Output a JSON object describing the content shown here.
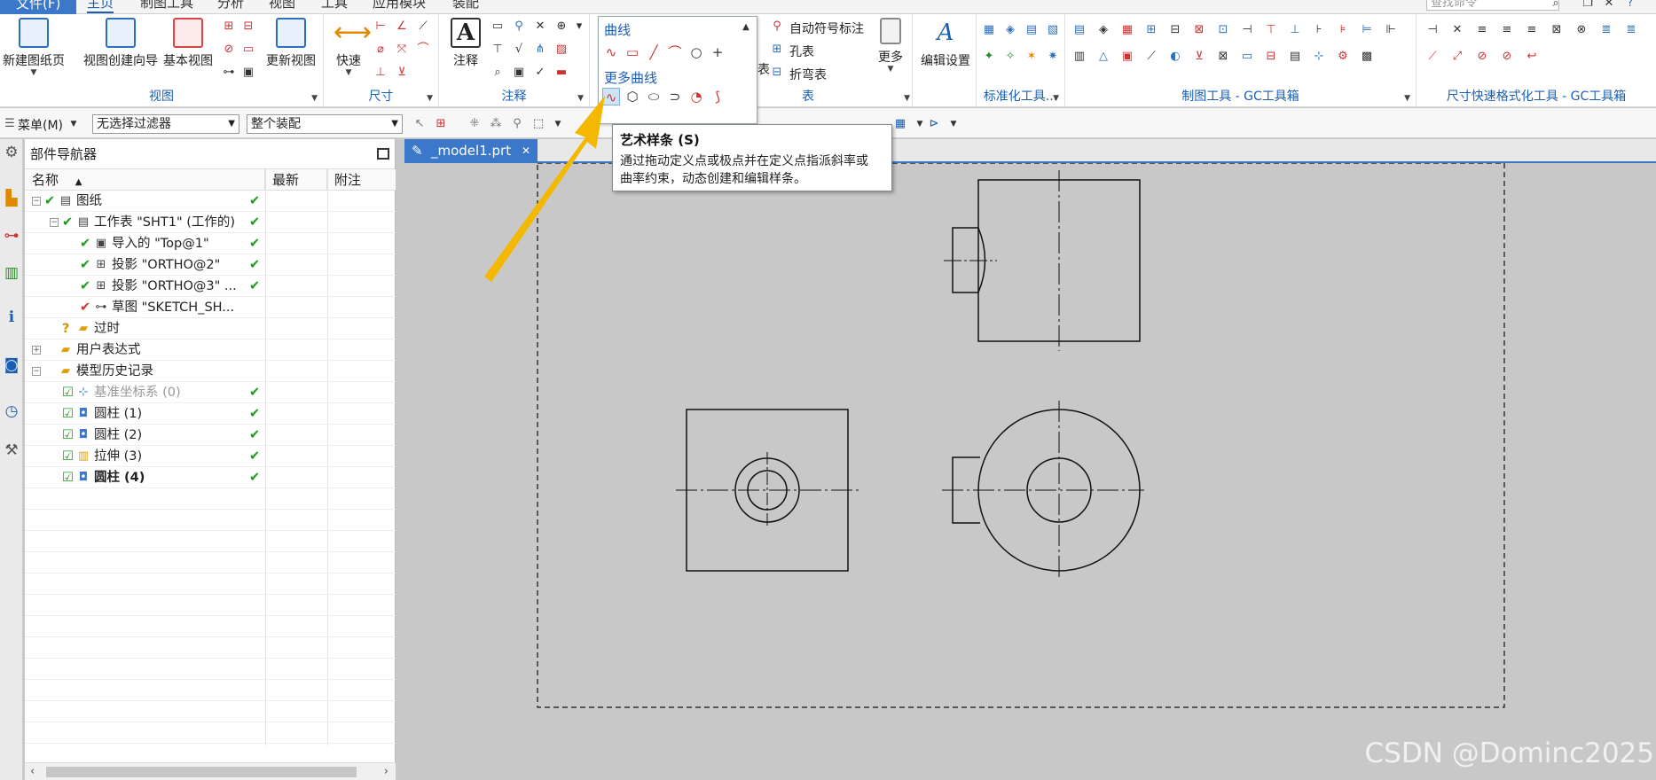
{
  "menubar": {
    "tabs": [
      "文件(F)",
      "主页",
      "制图工具",
      "分析",
      "视图",
      "工具",
      "应用模块",
      "装配"
    ],
    "search_placeholder": "查找命令"
  },
  "ribbon": {
    "new_sheet": "新建图纸页",
    "view_wizard": "视图创建向导",
    "base_view": "基本视图",
    "update_view": "更新视图",
    "group_view": "视图",
    "quick": "快速",
    "group_dimension": "尺寸",
    "annotation": "注释",
    "group_annotation": "注释",
    "auto_symbol": "自动符号标注",
    "hole_table": "孔表",
    "bend_table": "折弯表",
    "table_partial": "表",
    "group_table": "表",
    "more": "更多",
    "edit_settings": "编辑设置",
    "group_std": "标准化工具...",
    "group_gc": "制图工具 - GC工具箱",
    "group_dimfmt": "尺寸快速格式化工具 - GC工具箱"
  },
  "curve_panel": {
    "title": "曲线",
    "more_title": "更多曲线"
  },
  "toolbar2": {
    "menu_label": "菜单(M)",
    "filter": "无选择过滤器",
    "assembly": "整个装配"
  },
  "tooltip": {
    "title": "艺术样条 (S)",
    "line1": "通过拖动定义点或极点并在定义点指派斜率或",
    "line2": "曲率约束，动态创建和编辑样条。"
  },
  "navigator": {
    "title": "部件导航器",
    "col_name": "名称",
    "col_latest": "最新",
    "col_note": "附注",
    "rows": [
      {
        "label": "图纸",
        "indent": 0,
        "latest": "✔"
      },
      {
        "label": "工作表 \"SHT1\" (工作的)",
        "indent": 1,
        "latest": "✔"
      },
      {
        "label": "导入的 \"Top@1\"",
        "indent": 2,
        "latest": "✔"
      },
      {
        "label": "投影 \"ORTHO@2\"",
        "indent": 2,
        "latest": "✔"
      },
      {
        "label": "投影 \"ORTHO@3\" ...",
        "indent": 2,
        "latest": "✔"
      },
      {
        "label": "草图 \"SKETCH_SH...",
        "indent": 2,
        "latest": ""
      },
      {
        "label": "过时",
        "indent": 1,
        "latest": ""
      },
      {
        "label": "用户表达式",
        "indent": 0,
        "latest": ""
      },
      {
        "label": "模型历史记录",
        "indent": 0,
        "latest": ""
      },
      {
        "label": "基准坐标系 (0)",
        "indent": 1,
        "latest": "✔"
      },
      {
        "label": "圆柱 (1)",
        "indent": 1,
        "latest": "✔"
      },
      {
        "label": "圆柱 (2)",
        "indent": 1,
        "latest": "✔"
      },
      {
        "label": "拉伸 (3)",
        "indent": 1,
        "latest": "✔"
      },
      {
        "label": "圆柱 (4)",
        "indent": 1,
        "latest": "✔"
      }
    ]
  },
  "document_tab": "_model1.prt",
  "watermark": "CSDN @Dominc2025",
  "colors": {
    "accent": "#1a5fb4",
    "check": "#1c9a1c",
    "arrow": "#f5b800"
  }
}
